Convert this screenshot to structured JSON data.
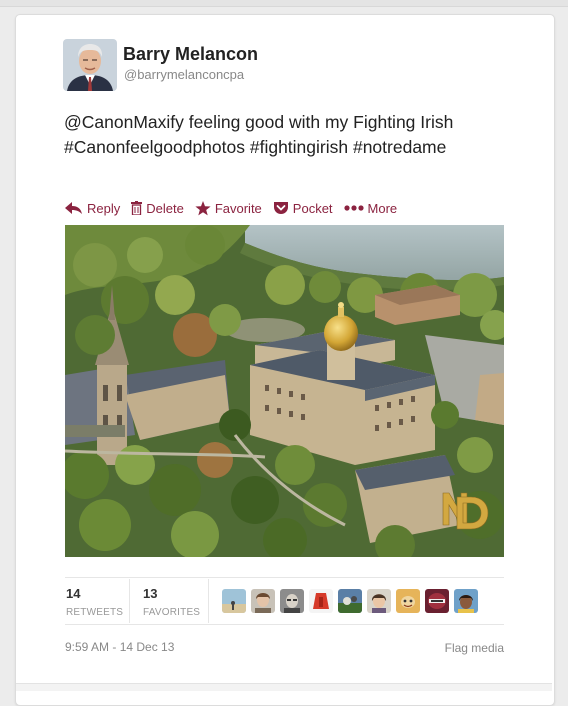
{
  "tweet": {
    "author_name": "Barry Melancon",
    "author_handle": "@barrymelanconcpa",
    "text_line1": "@CanonMaxify feeling good with my Fighting Irish",
    "text_line2": "#Canonfeelgoodphotos #fightingirish #notredame"
  },
  "actions": {
    "reply": "Reply",
    "delete": "Delete",
    "favorite": "Favorite",
    "pocket": "Pocket",
    "more": "More"
  },
  "stats": {
    "retweets_count": "14",
    "retweets_label": "RETWEETS",
    "favorites_count": "13",
    "favorites_label": "FAVORITES"
  },
  "footer": {
    "timestamp": "9:59 AM - 14 Dec 13",
    "flag_media": "Flag media"
  },
  "colors": {
    "accent": "#8b2340",
    "text": "#222222",
    "muted": "#888888"
  }
}
